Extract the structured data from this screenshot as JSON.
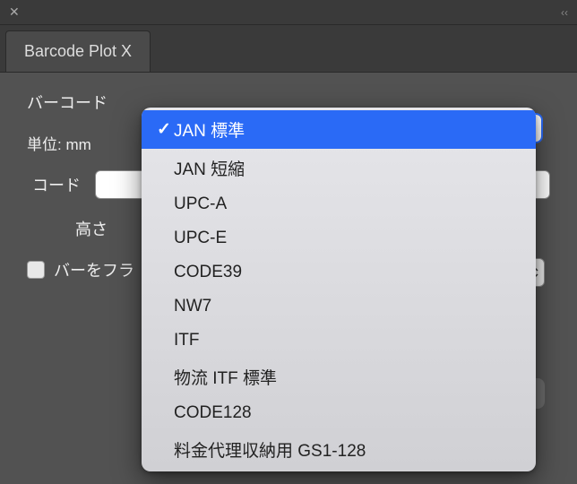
{
  "titlebar": {
    "collapse_hint": "‹‹"
  },
  "tab": {
    "label": "Barcode Plot X"
  },
  "labels": {
    "barcode": "バーコード",
    "unit": "単位: mm",
    "code": "コード",
    "height": "高さ",
    "flatten": "バーをフラ"
  },
  "dropdown": {
    "options": [
      "JAN 標準",
      "JAN 短縮",
      "UPC-A",
      "UPC-E",
      "CODE39",
      "NW7",
      "ITF",
      "物流 ITF 標準",
      "CODE128",
      "料金代理収納用 GS1-128"
    ],
    "selected_index": 0
  }
}
